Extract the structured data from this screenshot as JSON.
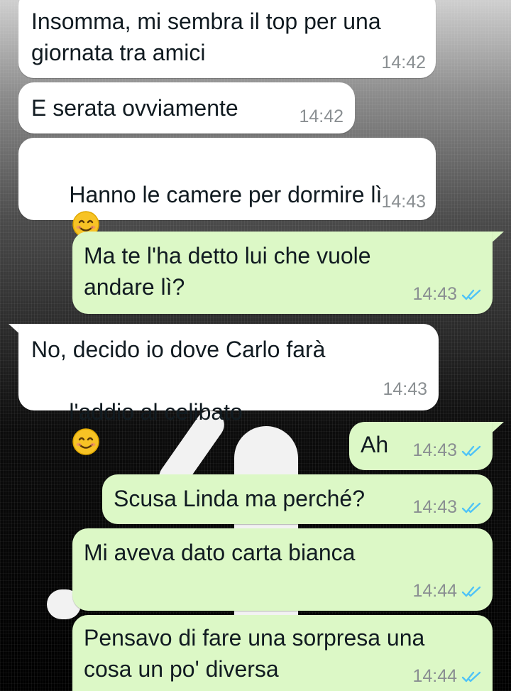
{
  "chat": {
    "messages": [
      {
        "direction": "incoming",
        "text_lines": [
          "Insomma, mi sembra il top per una",
          "giornata tra amici"
        ],
        "time": "14:42",
        "status": ""
      },
      {
        "direction": "incoming",
        "text_lines": [
          "E serata ovviamente"
        ],
        "time": "14:42",
        "status": ""
      },
      {
        "direction": "incoming",
        "text_lines": [
          "Hanno le camere per dormire lì"
        ],
        "emoji": "smiling-face-icon",
        "time": "14:43",
        "status": ""
      },
      {
        "direction": "outgoing",
        "text_lines": [
          "Ma te l'ha detto lui che vuole",
          "andare lì?"
        ],
        "time": "14:43",
        "status": "read"
      },
      {
        "direction": "incoming",
        "text_lines": [
          "No, decido io dove Carlo farà",
          "l'addio al celibato"
        ],
        "emoji": "smiling-face-icon",
        "time": "14:43",
        "status": ""
      },
      {
        "direction": "outgoing",
        "text_lines": [
          "Ah"
        ],
        "time": "14:43",
        "status": "read"
      },
      {
        "direction": "outgoing",
        "text_lines": [
          "Scusa Linda ma perché?"
        ],
        "time": "14:43",
        "status": "read"
      },
      {
        "direction": "outgoing",
        "text_lines": [
          "Mi aveva dato carta bianca"
        ],
        "time": "14:44",
        "status": "read"
      },
      {
        "direction": "outgoing",
        "text_lines": [
          "Pensavo di fare una sorpresa una",
          "cosa un po' diversa"
        ],
        "time": "14:44",
        "status": "read"
      }
    ]
  },
  "colors": {
    "incoming_bubble": "#ffffff",
    "outgoing_bubble": "#dcf8c6",
    "read_check": "#4fc3f7",
    "timestamp": "#8a8f92"
  }
}
